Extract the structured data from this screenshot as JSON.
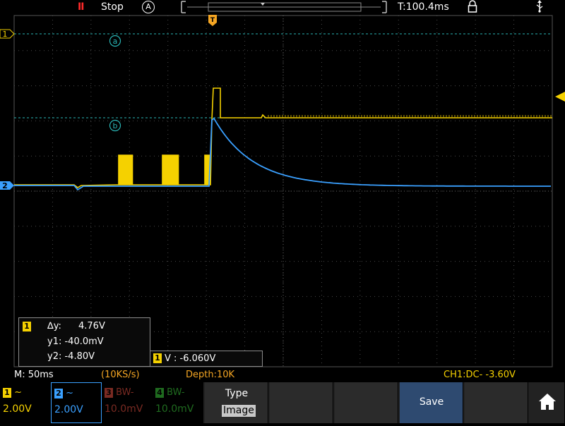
{
  "topbar": {
    "run_icon": "II",
    "run_state": "Stop",
    "trigger_mode": "A",
    "trigger_time": "T:100.4ms",
    "lock_icon": "lock-icon",
    "usb_icon": "usb-icon"
  },
  "screen": {
    "cursor_a": "a",
    "cursor_b": "b",
    "trigger_marker": "T",
    "ch1_marker": "1",
    "ch2_marker": "2"
  },
  "measure": {
    "channel": "1",
    "dy_label": "∆y:",
    "dy_value": "4.76V",
    "y1": "y1: -40.0mV",
    "y2": "y2: -4.80V"
  },
  "vbox": {
    "channel": "1",
    "text": "V : -6.060V"
  },
  "status": {
    "timebase": "M: 50ms",
    "sample_rate": "(10KS/s)",
    "depth": "Depth:10K",
    "trigger": "CH1:DC- -3.60V"
  },
  "softkeys": {
    "ch1": {
      "num": "1",
      "coupling": "~",
      "scale": "2.00V",
      "color": "#f5d100"
    },
    "ch2": {
      "num": "2",
      "coupling": "~",
      "scale": "2.00V",
      "color": "#3aa0ff"
    },
    "ch3": {
      "num": "3",
      "coupling": "BW-",
      "scale": "10.0mV",
      "color": "#7a2a22"
    },
    "ch4": {
      "num": "4",
      "coupling": "BW-",
      "scale": "10.0mV",
      "color": "#1f6b1f"
    },
    "type_label": "Type",
    "type_value": "Image",
    "save_label": "Save",
    "home_icon": "home-icon"
  },
  "colors": {
    "ch1": "#f5d100",
    "ch2": "#3aa0ff",
    "cursor": "#2ab5b5",
    "trigger": "#f5a623"
  }
}
